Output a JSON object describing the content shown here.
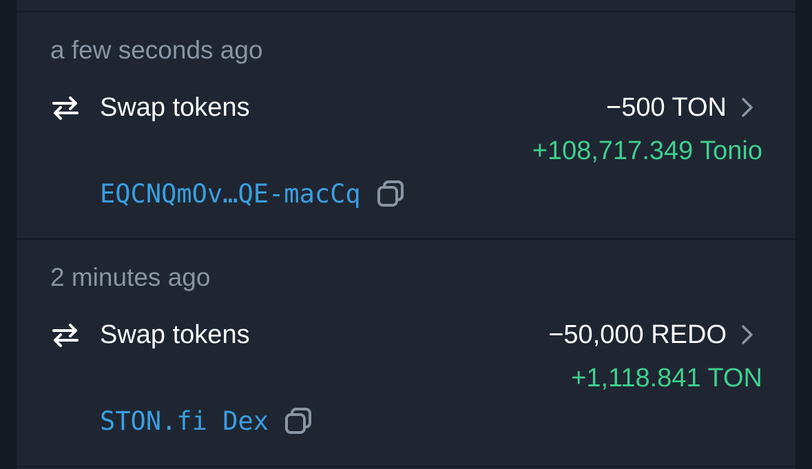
{
  "transactions": [
    {
      "time": "a few seconds ago",
      "type": "Swap tokens",
      "out_amount": "−500 TON",
      "in_amount": "+108,717.349 Tonio",
      "address": "EQCNQmOv…QE-macCq"
    },
    {
      "time": "2 minutes ago",
      "type": "Swap tokens",
      "out_amount": "−50,000 REDO",
      "in_amount": "+1,118.841 TON",
      "address": "STON.fi Dex"
    }
  ],
  "icons": {
    "swap": "swap-arrows-icon",
    "chevron": "chevron-right-icon",
    "copy": "copy-icon"
  },
  "colors": {
    "background": "#1f2632",
    "outer_background": "#141a22",
    "time_text": "#8a94a3",
    "primary_text": "#ffffff",
    "incoming_amount": "#3fcf8e",
    "address_link": "#3a9ee0"
  }
}
